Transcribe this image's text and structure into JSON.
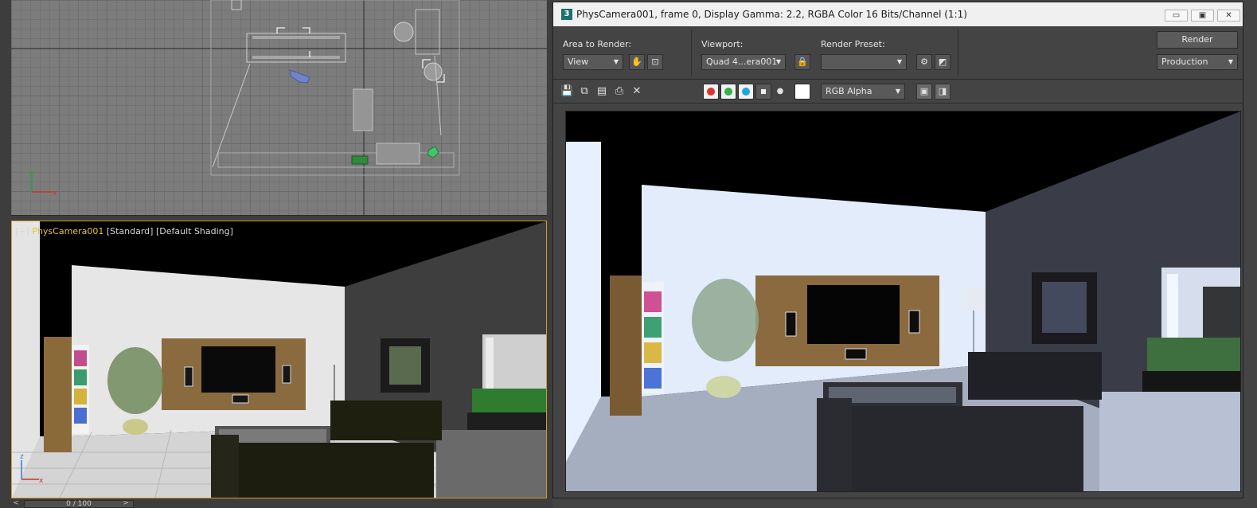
{
  "viewport_top": {
    "axis_x": "x",
    "axis_y": "y"
  },
  "viewport_persp": {
    "label_plus": "[+]",
    "label_camera": "PhysCamera001",
    "label_standard": "[Standard]",
    "label_shading": "[Default Shading]",
    "axis_x": "x",
    "axis_z": "z"
  },
  "time_slider": {
    "value": "0 / 100",
    "prev": "<",
    "next": ">"
  },
  "render_window": {
    "app_icon": "3",
    "title": "PhysCamera001, frame 0, Display Gamma: 2.2, RGBA Color 16 Bits/Channel (1:1)",
    "minimize": "▭",
    "maximize": "▣",
    "close": "✕",
    "area_to_render_label": "Area to Render:",
    "area_to_render_value": "View",
    "viewport_label": "Viewport:",
    "viewport_value": "Quad 4...era001",
    "render_preset_label": "Render Preset:",
    "render_preset_value": "",
    "render_button": "Render",
    "production_value": "Production",
    "channel_display": "RGB Alpha",
    "icons": {
      "save": "💾",
      "copy": "⧉",
      "clone": "▤",
      "print": "⎙",
      "clear": "✕",
      "lock": "🔒"
    },
    "colors": {
      "red_channel": "#e53030",
      "green_channel": "#2fb34a",
      "blue_channel": "#1da7e0",
      "accent_viewport_border": "#c9a12c",
      "camera_label": "#e9c435"
    }
  }
}
